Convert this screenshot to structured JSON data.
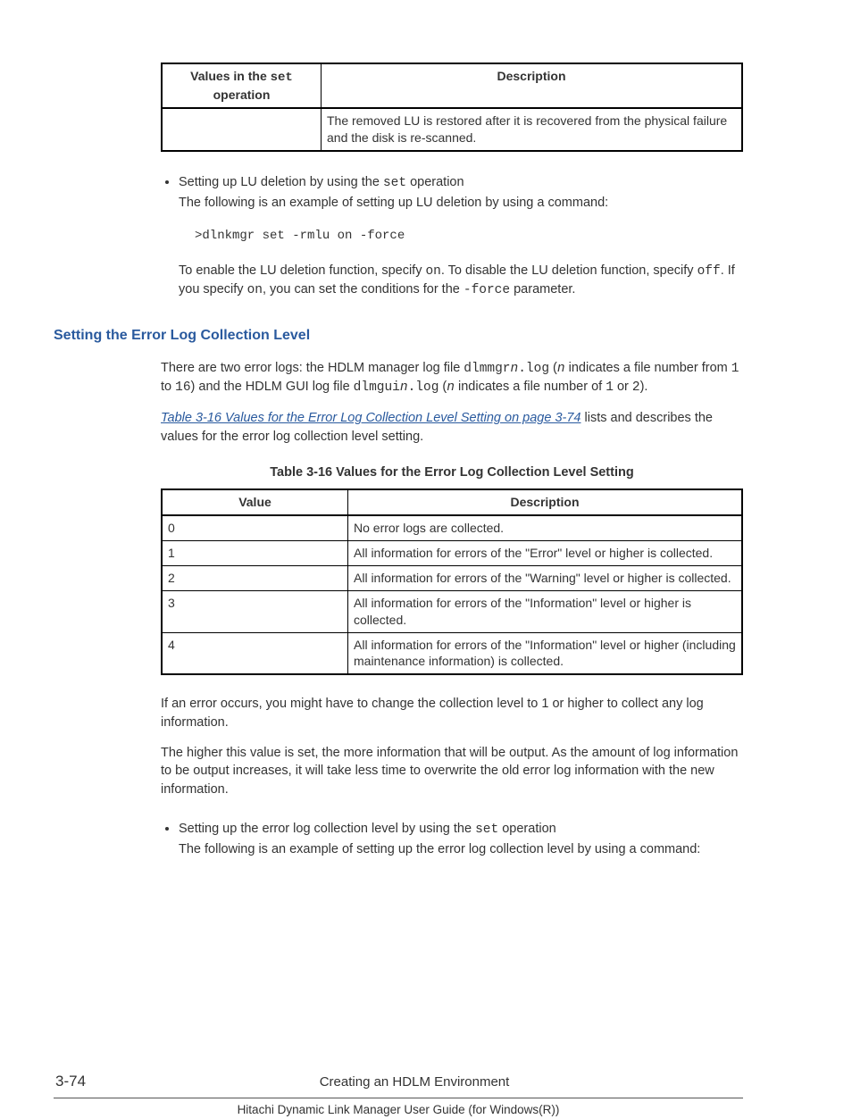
{
  "table1": {
    "h1_a": "Values in the ",
    "h1_b": "set",
    "h1_c": " operation",
    "h2": "Description",
    "cell_a": "",
    "cell_b": "The removed LU is restored after it is recovered from the physical failure and the disk is re-scanned."
  },
  "bullet1": {
    "lead_a": "Setting up LU deletion by using the ",
    "lead_b": "set",
    "lead_c": " operation",
    "body": "The following is an example of setting up LU deletion by using a command:",
    "code": ">dlnkmgr set -rmlu on -force",
    "p2_a": "To enable the LU deletion function, specify ",
    "p2_b": "on",
    "p2_c": ". To disable the LU deletion function, specify ",
    "p2_d": "off",
    "p2_e": ". If you specify ",
    "p2_f": "on",
    "p2_g": ", you can set the conditions for the ",
    "p2_h": "-force",
    "p2_i": " parameter."
  },
  "section": {
    "title": "Setting the Error Log Collection Level",
    "p1_a": "There are two error logs: the HDLM manager log file ",
    "p1_b": "dlmmgr",
    "p1_c": "n",
    "p1_d": ".log",
    "p1_e": " (",
    "p1_f": "n",
    "p1_g": " indicates a file number from ",
    "p1_h": "1",
    "p1_i": " to ",
    "p1_j": "16",
    "p1_k": ") and the HDLM GUI log file ",
    "p1_l": "dlmgui",
    "p1_m": "n",
    "p1_n": ".log",
    "p1_o": " (",
    "p1_p": "n",
    "p1_q": " indicates a file number of ",
    "p1_r": "1",
    "p1_s": " or ",
    "p1_t": "2",
    "p1_u": ").",
    "xref": "Table 3-16 Values for the Error Log Collection Level Setting on page 3-74",
    "p2_b": " lists and describes the values for the error log collection level setting."
  },
  "table2": {
    "caption": "Table 3-16 Values for the Error Log Collection Level Setting",
    "h1": "Value",
    "h2": "Description",
    "rows": {
      "0": {
        "v": "0",
        "d": "No error logs are collected."
      },
      "1": {
        "v": "1",
        "d": "All information for errors of the \"Error\" level or higher is collected."
      },
      "2": {
        "v": "2",
        "d": "All information for errors of the \"Warning\" level or higher is collected."
      },
      "3": {
        "v": "3",
        "d": "All information for errors of the \"Information\" level or higher is collected."
      },
      "4": {
        "v": "4",
        "d": "All information for errors of the \"Information\" level or higher (including maintenance information) is collected."
      }
    }
  },
  "after": {
    "p1": "If an error occurs, you might have to change the collection level to 1 or higher to collect any log information.",
    "p2": "The higher this value is set, the more information that will be output. As the amount of log information to be output increases, it will take less time to overwrite the old error log information with the new information."
  },
  "bullet2": {
    "lead_a": "Setting up the error log collection level by using the ",
    "lead_b": "set",
    "lead_c": " operation",
    "body": "The following is an example of setting up the error log collection level by using a command:"
  },
  "footer": {
    "page": "3-74",
    "chapter": "Creating an HDLM Environment",
    "book": "Hitachi Dynamic Link Manager User Guide (for Windows(R))"
  }
}
